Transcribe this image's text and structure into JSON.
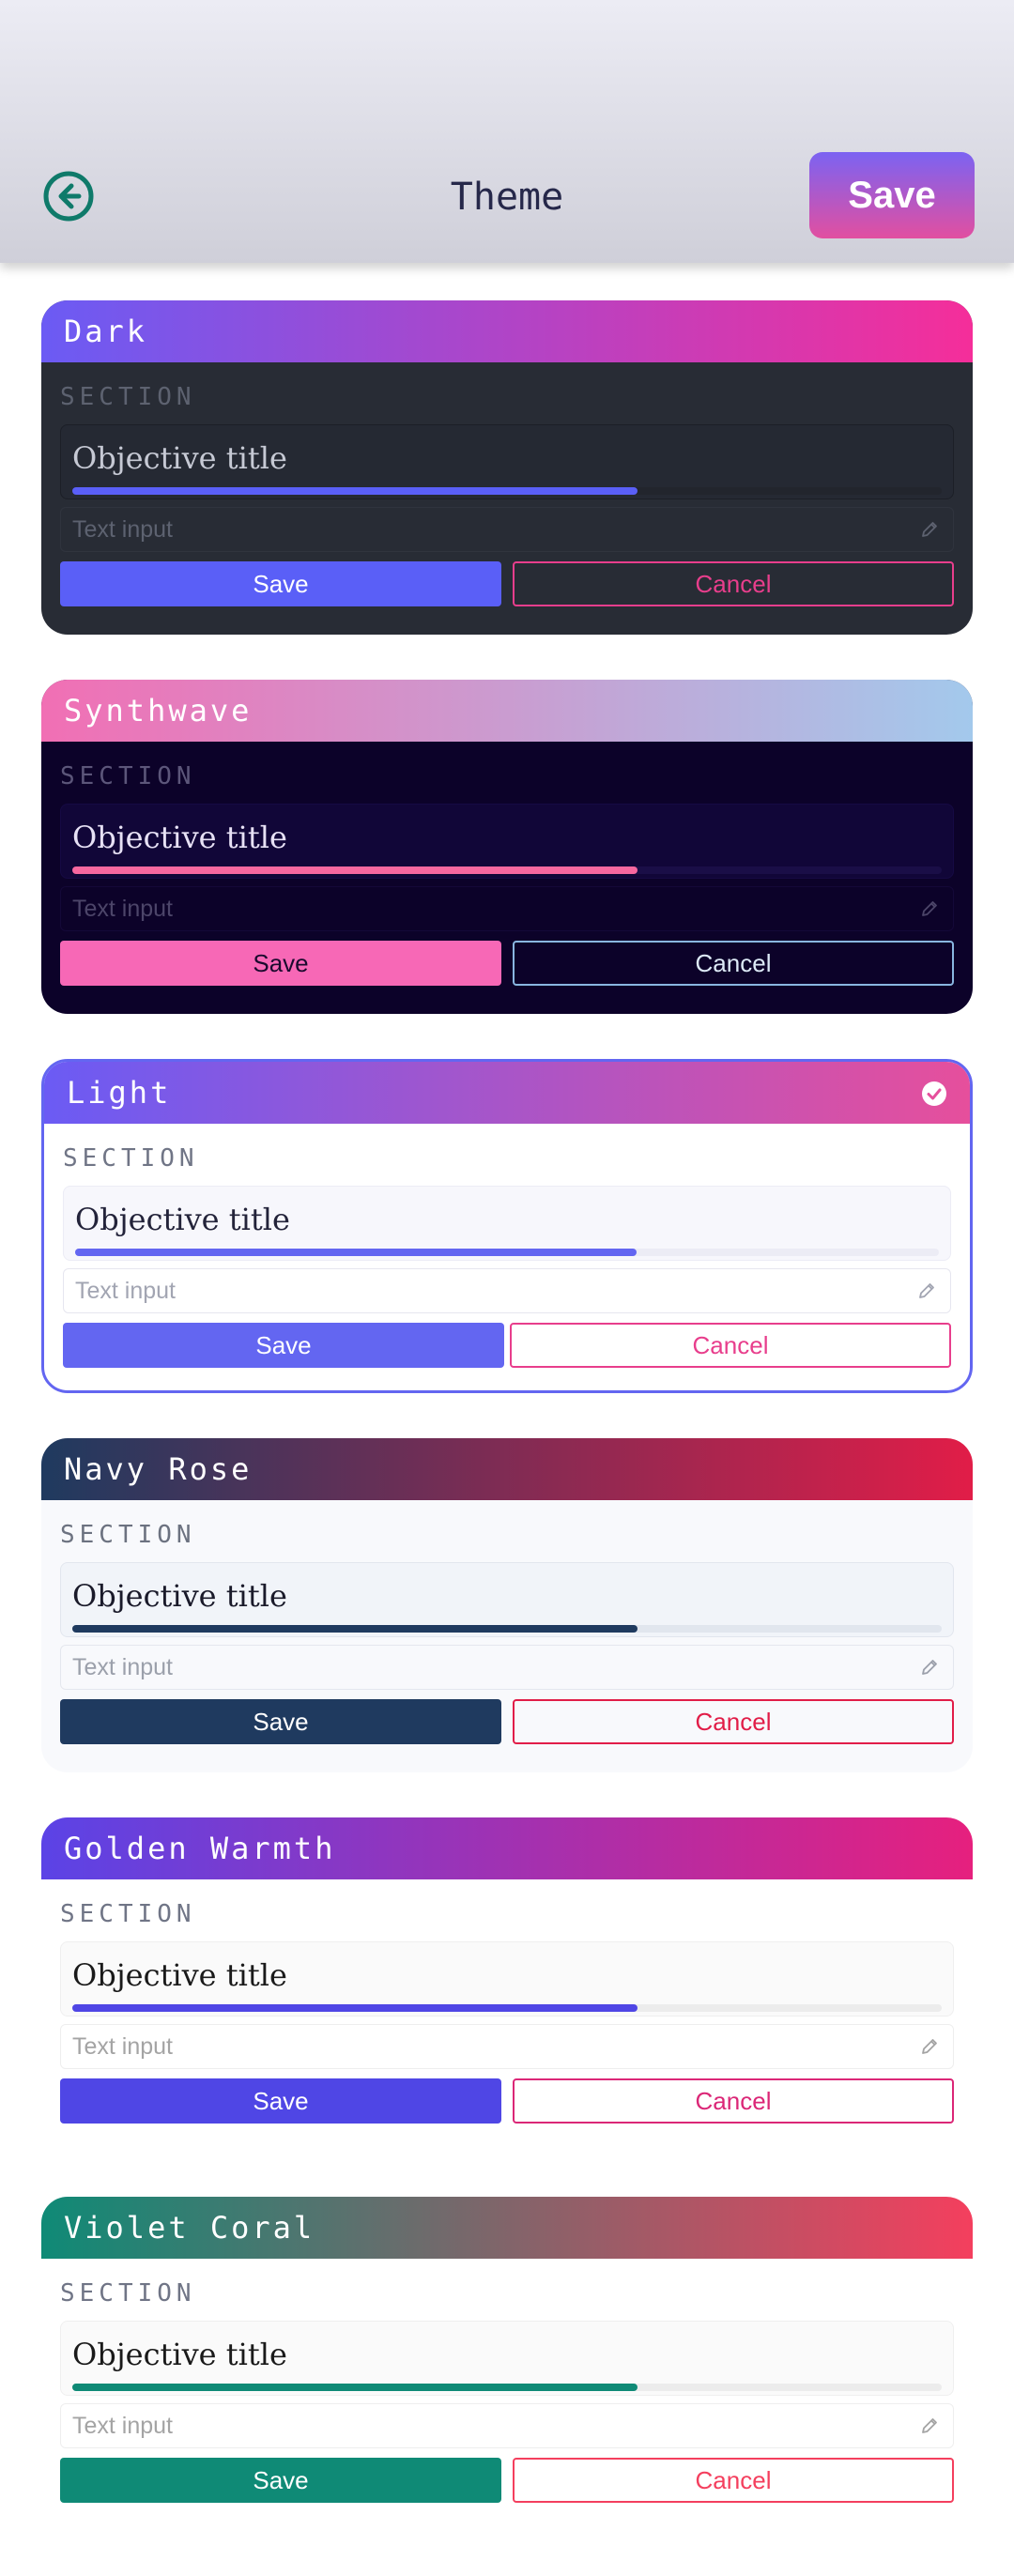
{
  "header": {
    "title": "Theme",
    "save_label": "Save",
    "back_icon": "arrow-left-circle-icon",
    "accent": "#0f7a6a"
  },
  "card_common": {
    "section": "SECTION",
    "objective": "Objective title",
    "text_input_placeholder": "Text input",
    "save": "Save",
    "cancel": "Cancel",
    "progress": 0.65
  },
  "themes": [
    {
      "name": "Dark",
      "selected": false,
      "colors": {
        "header_from": "#6b5bf4",
        "header_to": "#f52e9a",
        "body": "#282c35",
        "section": "#5d6270",
        "obj_bg": "#252933",
        "obj_border": "#1c1f27",
        "obj_text": "#c6c9d4",
        "track": "#22252d",
        "fill": "#5a5ff7",
        "input_bg": "#282c35",
        "input_border": "#30343e",
        "input_text": "#5d6270",
        "save_bg": "#5a5ff7",
        "save_text": "#ffffff",
        "cancel_border": "#e83e8c",
        "cancel_text": "#e83e8c"
      }
    },
    {
      "name": "Synthwave",
      "selected": false,
      "colors": {
        "header_from": "#f16fb4",
        "header_to": "#a3c9ec",
        "body": "#0c0229",
        "section": "#5c567a",
        "obj_bg": "#110638",
        "obj_border": "#160a44",
        "obj_text": "#e7e1f5",
        "track": "#1a0e47",
        "fill": "#f7679f",
        "input_bg": "#0c0229",
        "input_border": "#140838",
        "input_text": "#4c4569",
        "save_bg": "#f768b6",
        "save_text": "#1b0a2e",
        "cancel_border": "#89b6e0",
        "cancel_text": "#ddeaf7"
      }
    },
    {
      "name": "Light",
      "selected": true,
      "colors": {
        "header_from": "#6b5bf4",
        "header_to": "#e64f9c",
        "body": "#ffffff",
        "section": "#707586",
        "obj_bg": "#f7f7fc",
        "obj_border": "#ececf5",
        "obj_text": "#23233a",
        "track": "#ececf5",
        "fill": "#6366f1",
        "input_bg": "#ffffff",
        "input_border": "#e6e6ef",
        "input_text": "#a2a5b2",
        "save_bg": "#6366f1",
        "save_text": "#ffffff",
        "cancel_border": "#e83e8c",
        "cancel_text": "#e83e8c"
      }
    },
    {
      "name": "Navy Rose",
      "selected": false,
      "colors": {
        "header_from": "#1f3a5f",
        "header_to": "#e11d48",
        "body": "#f8f9fc",
        "section": "#6c7280",
        "obj_bg": "#f1f4f9",
        "obj_border": "#e2e6ee",
        "obj_text": "#1a1a2a",
        "track": "#e1e6ee",
        "fill": "#1f3a5f",
        "input_bg": "#f8f9fc",
        "input_border": "#e4e7ee",
        "input_text": "#9ba0ab",
        "save_bg": "#1f3a5f",
        "save_text": "#ffffff",
        "cancel_border": "#e11d48",
        "cancel_text": "#e11d48"
      }
    },
    {
      "name": "Golden Warmth",
      "selected": false,
      "colors": {
        "header_from": "#5b43e6",
        "header_to": "#e6207e",
        "body": "#ffffff",
        "section": "#707586",
        "obj_bg": "#fafafa",
        "obj_border": "#efefef",
        "obj_text": "#1a1a1a",
        "track": "#ececec",
        "fill": "#4f46e5",
        "input_bg": "#ffffff",
        "input_border": "#eeeeee",
        "input_text": "#a4a4a4",
        "save_bg": "#4f46e5",
        "save_text": "#ffffff",
        "cancel_border": "#db2777",
        "cancel_text": "#db2777"
      }
    },
    {
      "name": "Violet Coral",
      "selected": false,
      "colors": {
        "header_from": "#0f8a76",
        "header_to": "#f43f5e",
        "body": "#ffffff",
        "section": "#707586",
        "obj_bg": "#fafafa",
        "obj_border": "#efefef",
        "obj_text": "#1a1a1a",
        "track": "#ececec",
        "fill": "#0f8a76",
        "input_bg": "#ffffff",
        "input_border": "#eeeeee",
        "input_text": "#a4a4a4",
        "save_bg": "#0f8a76",
        "save_text": "#ffffff",
        "cancel_border": "#f43f5e",
        "cancel_text": "#f43f5e"
      }
    }
  ],
  "icons": {
    "edit": "pencil-icon",
    "selected": "check-circle-icon"
  }
}
